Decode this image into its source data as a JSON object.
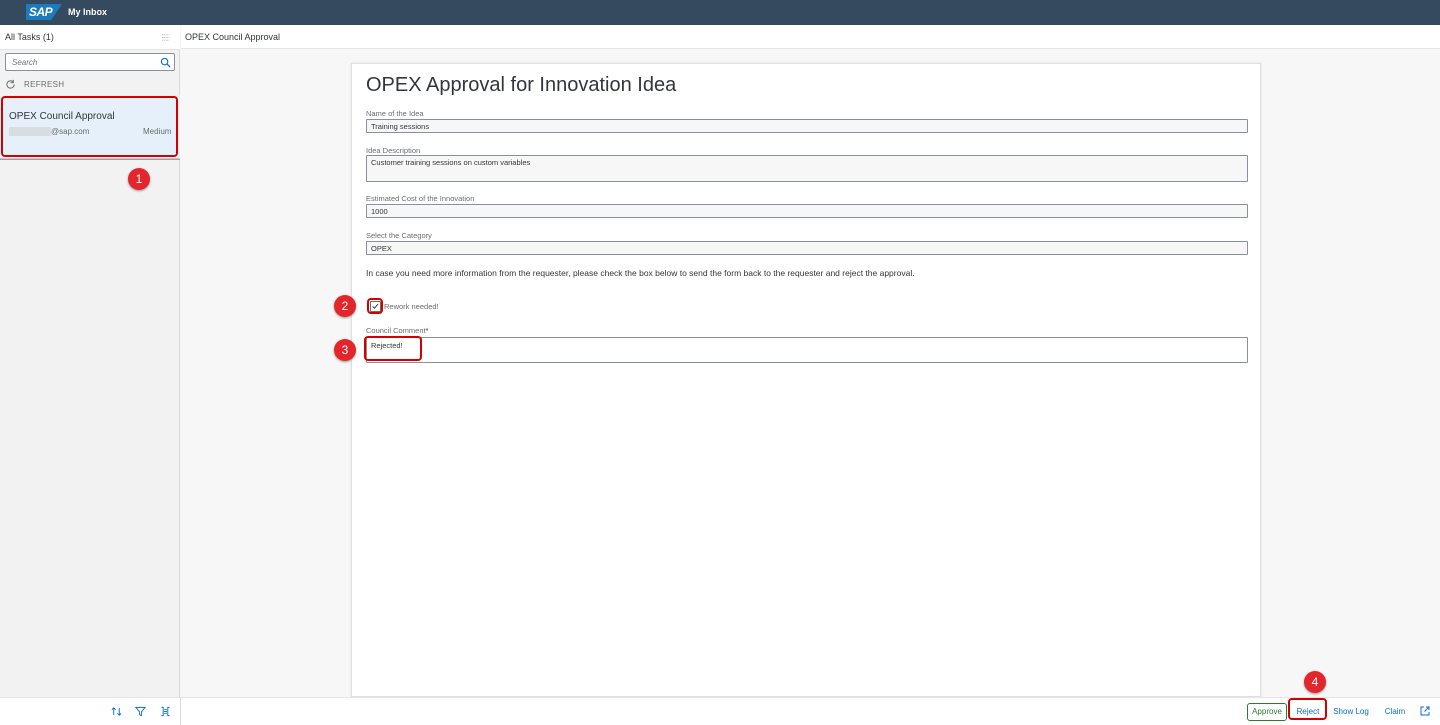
{
  "shell": {
    "logo": "SAP",
    "title": "My Inbox"
  },
  "master": {
    "title": "All Tasks (1)",
    "search_placeholder": "Search",
    "refresh_label": "REFRESH",
    "task": {
      "title": "OPEX Council Approval",
      "email": "@sap.com",
      "priority": "Medium"
    }
  },
  "detail": {
    "header_title": "OPEX Council Approval",
    "form": {
      "title": "OPEX Approval for Innovation Idea",
      "fields": [
        {
          "label": "Name of the Idea",
          "value": "Training sessions"
        },
        {
          "label": "Idea Description",
          "value": "Customer training sessions on custom variables"
        },
        {
          "label": "Estimated Cost of the Innovation",
          "value": "1000"
        },
        {
          "label": "Select the Category",
          "value": "OPEX"
        }
      ],
      "info_text": "In case you need more information from the requester, please check the box below to send the form back to the requester and reject the approval.",
      "checkbox": {
        "label": "Rework needed!",
        "checked": true
      },
      "comment": {
        "label": "Council Comment",
        "required_mark": "*",
        "value": "Rejected!"
      }
    }
  },
  "footer": {
    "approve": "Approve",
    "reject": "Reject",
    "show_log": "Show Log",
    "claim": "Claim"
  },
  "annotations": [
    "1",
    "2",
    "3",
    "4"
  ],
  "colors": {
    "shell": "#354a5f",
    "highlight": "#d40000",
    "badge": "#e3262b",
    "approve": "#2b7d2b",
    "link": "#0a6ed1"
  }
}
